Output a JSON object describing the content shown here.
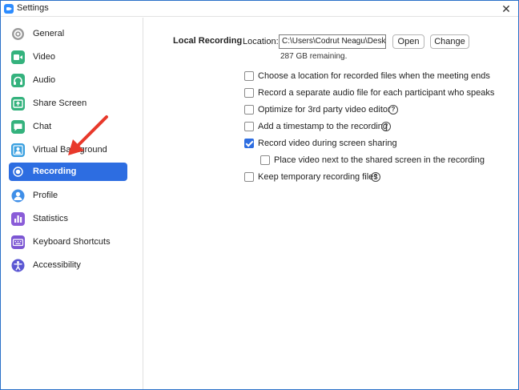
{
  "window": {
    "title": "Settings",
    "close_glyph": "✕"
  },
  "sidebar": {
    "items": [
      {
        "label": "General",
        "icon": "gear-icon",
        "color": "#8a8a8a"
      },
      {
        "label": "Video",
        "icon": "video-icon",
        "color": "#34b27d"
      },
      {
        "label": "Audio",
        "icon": "headphones-icon",
        "color": "#34b27d"
      },
      {
        "label": "Share Screen",
        "icon": "share-screen-icon",
        "color": "#34b27d"
      },
      {
        "label": "Chat",
        "icon": "chat-icon",
        "color": "#34b27d"
      },
      {
        "label": "Virtual Background",
        "icon": "person-icon",
        "color": "#3aa0e0"
      },
      {
        "label": "Recording",
        "icon": "record-icon",
        "color": "#ffffff",
        "active": true
      },
      {
        "label": "Profile",
        "icon": "profile-icon",
        "color": "#3f8fe8"
      },
      {
        "label": "Statistics",
        "icon": "bar-chart-icon",
        "color": "#8a5cd8"
      },
      {
        "label": "Keyboard Shortcuts",
        "icon": "keyboard-icon",
        "color": "#7b55d3"
      },
      {
        "label": "Accessibility",
        "icon": "accessibility-icon",
        "color": "#5b57d3"
      }
    ]
  },
  "recording": {
    "section_title": "Local Recording",
    "location_label": "Location:",
    "location_value": "C:\\Users\\Codrut Neagu\\Desktop",
    "open_label": "Open",
    "change_label": "Change",
    "remaining": "287 GB remaining.",
    "options": [
      {
        "label": "Choose a location for recorded files when the meeting ends",
        "checked": false,
        "help": false
      },
      {
        "label": "Record a separate audio file for each participant who speaks",
        "checked": false,
        "help": false
      },
      {
        "label": "Optimize for 3rd party video editor",
        "checked": false,
        "help": true
      },
      {
        "label": "Add a timestamp to the recording",
        "checked": false,
        "help": true
      },
      {
        "label": "Record video during screen sharing",
        "checked": true,
        "help": false
      },
      {
        "label": "Place video next to the shared screen in the recording",
        "checked": false,
        "help": false,
        "indent": true
      },
      {
        "label": "Keep temporary recording files",
        "checked": false,
        "help": true
      }
    ],
    "help_glyph": "?"
  },
  "colors": {
    "accent": "#2d6de1",
    "arrow": "#e8392b"
  }
}
